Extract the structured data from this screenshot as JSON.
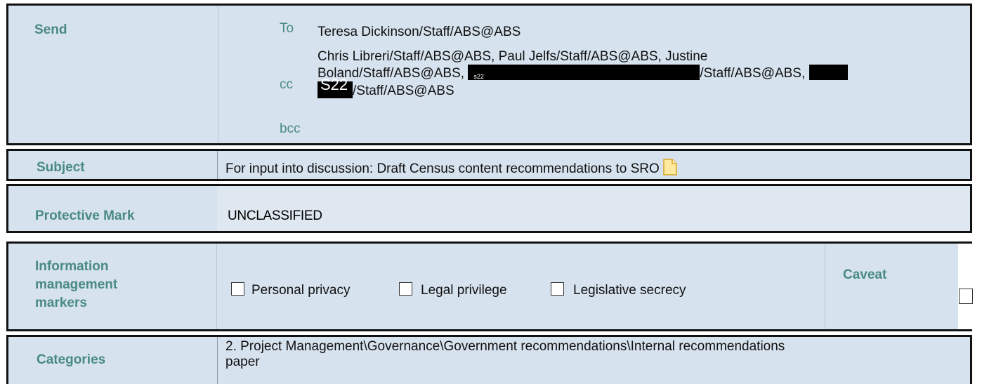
{
  "send": {
    "label": "Send",
    "to_label": "To",
    "to_value": "Teresa Dickinson/Staff/ABS@ABS",
    "cc_label": "cc",
    "cc_line1": "Chris Libreri/Staff/ABS@ABS, Paul Jelfs/Staff/ABS@ABS, Justine",
    "cc_line2_start": "Boland/Staff/ABS@ABS,",
    "cc_redaction_code_1": "s22",
    "cc_line2_mid": "/Staff/ABS@ABS,",
    "cc_redaction_code_2": "S22",
    "cc_line3_end": "/Staff/ABS@ABS",
    "bcc_label": "bcc"
  },
  "subject": {
    "label": "Subject",
    "value": "For input into discussion:  Draft Census content recommendations to SRO"
  },
  "protective_mark": {
    "label": "Protective Mark",
    "value": "UNCLASSIFIED"
  },
  "info_markers": {
    "label_line1": "Information",
    "label_line2": "management",
    "label_line3": "markers",
    "options": [
      {
        "label": "Personal privacy",
        "checked": false
      },
      {
        "label": "Legal privilege",
        "checked": false
      },
      {
        "label": "Legislative secrecy",
        "checked": false
      }
    ],
    "caveat_label": "Caveat"
  },
  "categories": {
    "label": "Categories",
    "value_line1": "2. Project Management\\Governance\\Government recommendations\\Internal recommendations",
    "value_line2": "paper"
  },
  "colors": {
    "panel": "#d6e2ee",
    "label": "#4a8a84",
    "border": "#111111"
  }
}
